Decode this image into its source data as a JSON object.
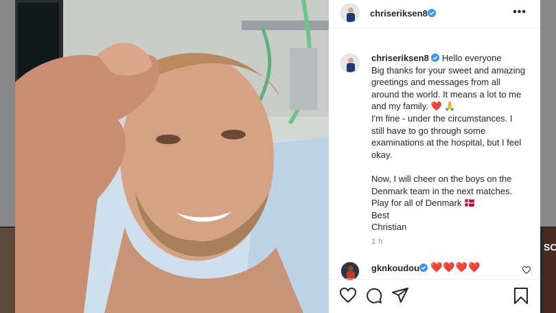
{
  "post": {
    "author": "chriseriksen8",
    "more_icon": "more-horizontal-icon",
    "caption_author": "chriseriksen8",
    "caption_lines": [
      "Hello everyone",
      "Big thanks for your sweet and amazing",
      "greetings and messages from all",
      "around the world. It means a lot to me",
      "and my family. ❤️ 🙏",
      "I'm fine - under the circumstances. I",
      "still have to go through some",
      "examinations at the hospital, but I feel",
      "okay.",
      "",
      "Now, I will cheer on the boys on the",
      "Denmark team in the next matches.",
      "Play for all of Denmark 🇩🇰",
      "Best",
      "Christian"
    ],
    "time_ago": "1 h"
  },
  "comment": {
    "author": "gknkoudou",
    "text": "❤️❤️❤️❤️"
  },
  "actions": {
    "like_icon": "heart-outline-icon",
    "comment_icon": "comment-icon",
    "share_icon": "share-icon",
    "save_icon": "bookmark-icon"
  },
  "colors": {
    "verified": "#3897f0",
    "heart": "#ed4956",
    "text": "#262626",
    "muted": "#8e8e8e"
  },
  "background": {
    "side_text": "SC"
  }
}
